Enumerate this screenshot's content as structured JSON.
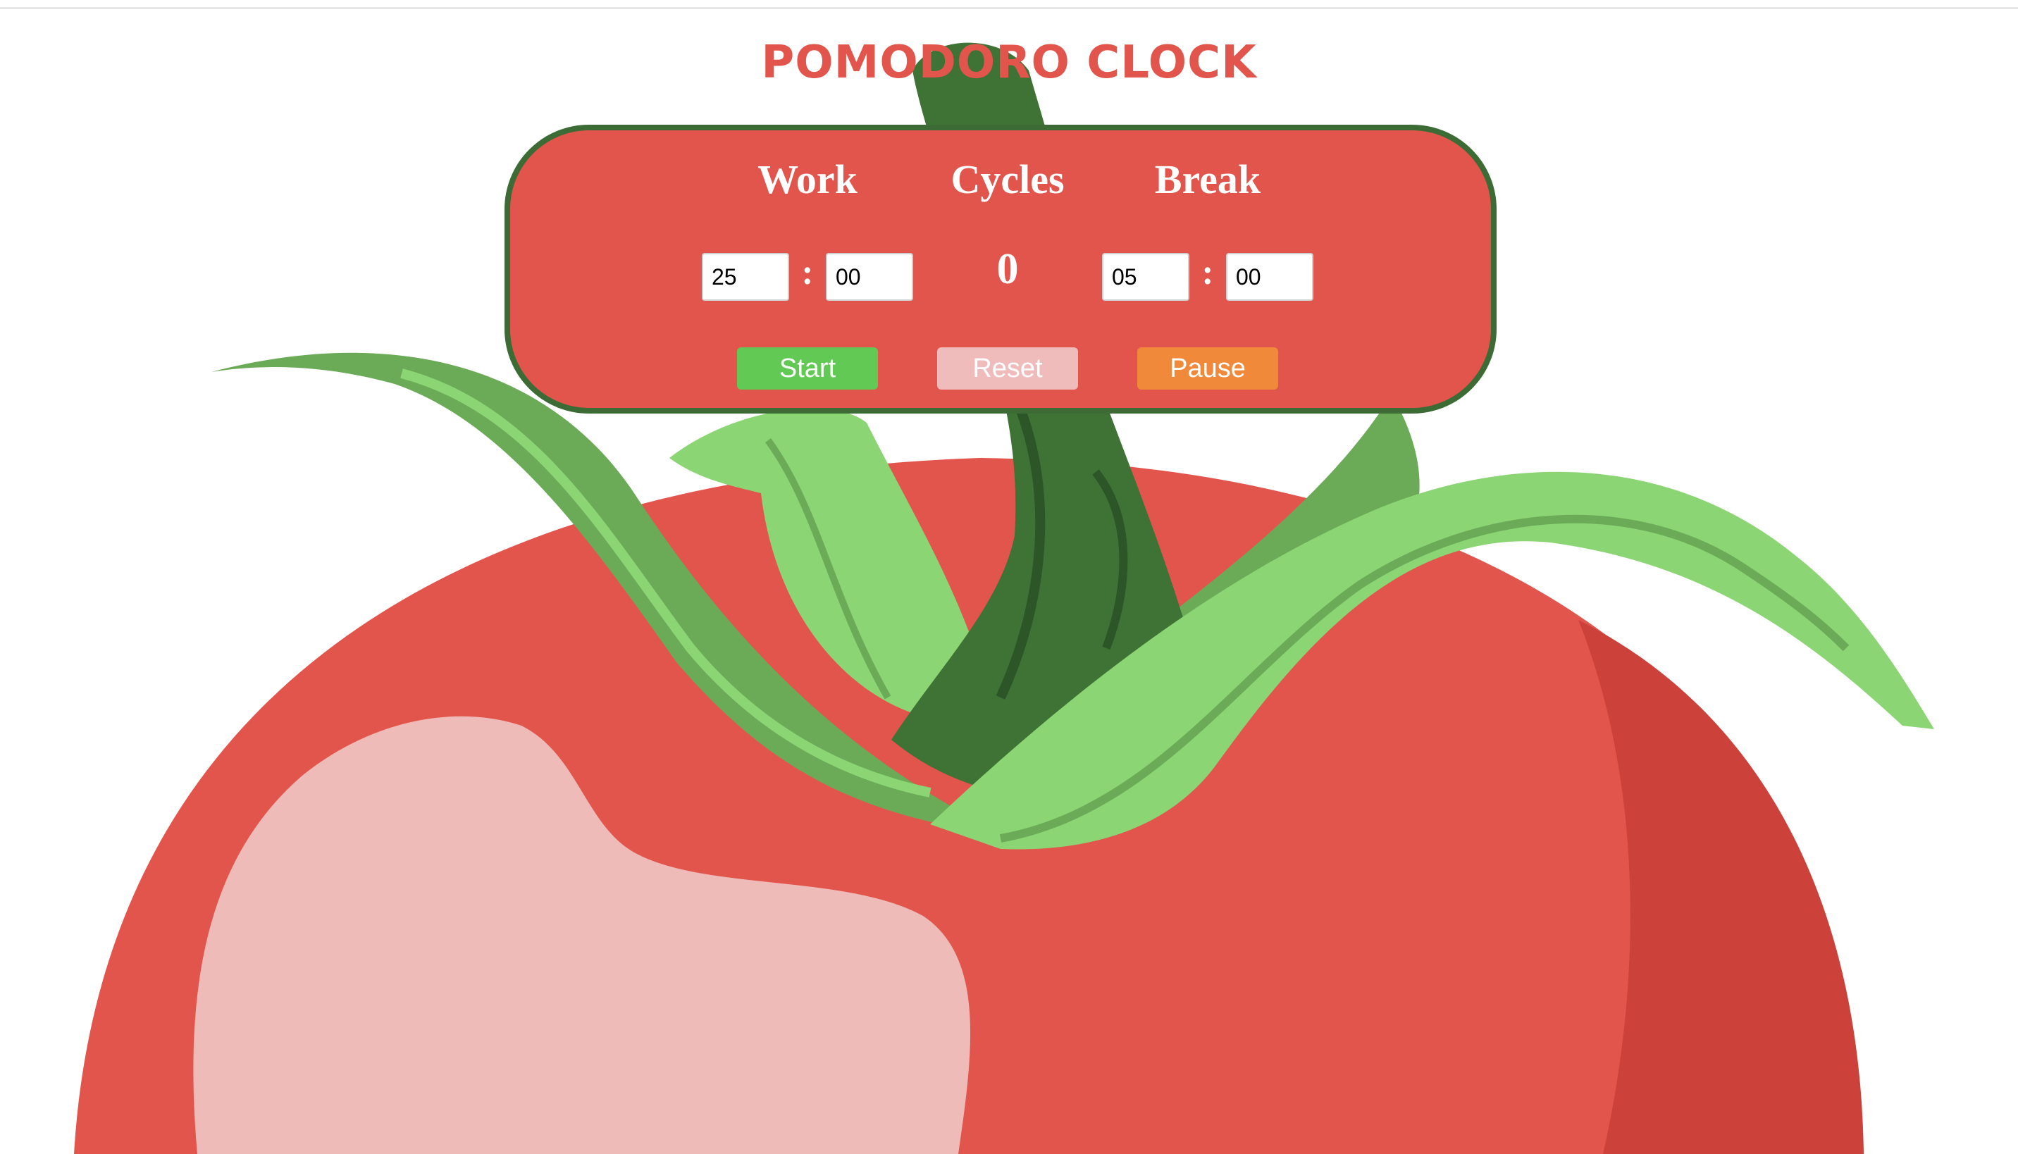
{
  "title": "POMODORO CLOCK",
  "colors": {
    "tomato": "#e2554c",
    "tomato_shade": "#cc423a",
    "highlight": "#efbbb8",
    "panel_border": "#3d6b35",
    "leaf_light": "#8bd574",
    "leaf_mid": "#6bab57",
    "stem": "#3f7235",
    "start": "#63c955",
    "reset": "#efbbbb",
    "pause": "#f08a3a"
  },
  "work": {
    "label": "Work",
    "minutes": "25",
    "seconds": "00",
    "separator": ":"
  },
  "cycles": {
    "label": "Cycles",
    "value": "0"
  },
  "break": {
    "label": "Break",
    "minutes": "05",
    "seconds": "00",
    "separator": ":"
  },
  "buttons": {
    "start": "Start",
    "reset": "Reset",
    "pause": "Pause"
  }
}
